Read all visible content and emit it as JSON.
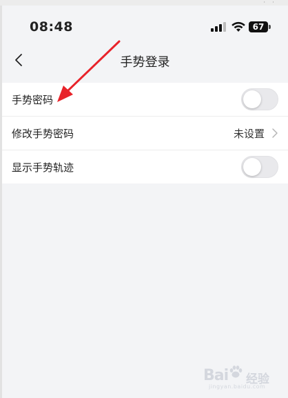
{
  "status_bar": {
    "time": "08:48",
    "battery": "67"
  },
  "nav": {
    "title": "手势登录"
  },
  "settings": {
    "gesture_password": {
      "label": "手势密码",
      "enabled": false
    },
    "modify_gesture_password": {
      "label": "修改手势密码",
      "value": "未设置"
    },
    "show_gesture_trace": {
      "label": "显示手势轨迹",
      "enabled": false
    }
  },
  "watermark": {
    "brand": "Bai",
    "brand_suffix": "经验",
    "url": "jingyan.baidu.com"
  },
  "colors": {
    "annotation_arrow": "#e8232a",
    "toggle_off": "#e9e9ec",
    "page_background": "#f3f4f6"
  }
}
